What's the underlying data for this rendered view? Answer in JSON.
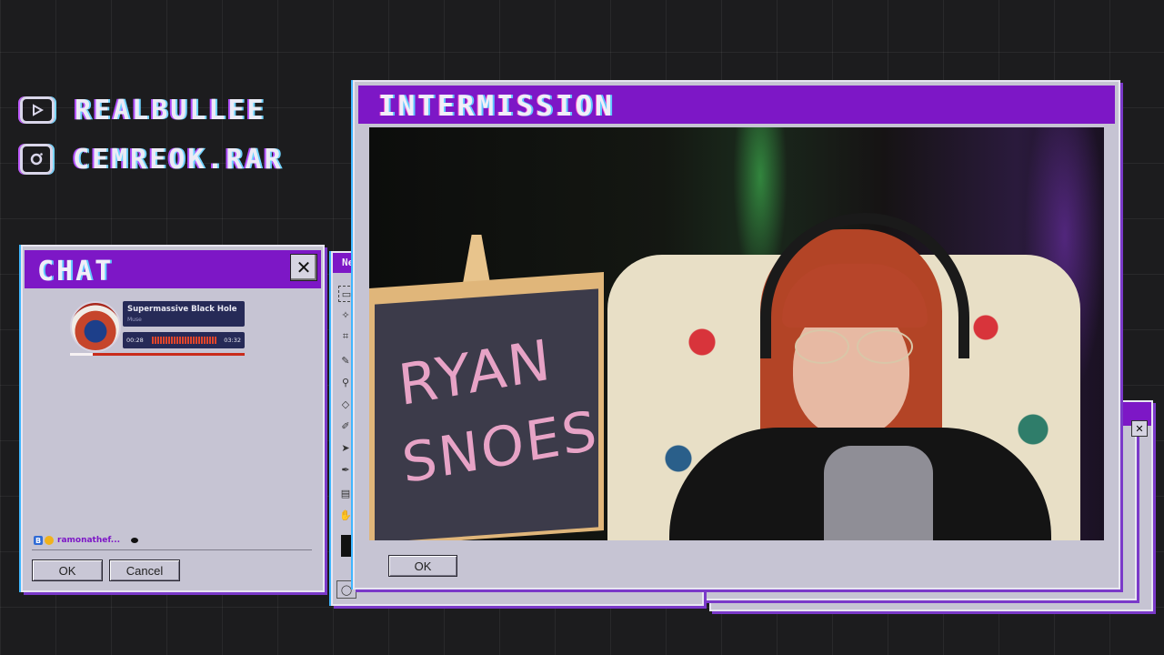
{
  "socials": [
    {
      "icon": "youtube-icon",
      "handle": "REALBULLEE"
    },
    {
      "icon": "instagram-icon",
      "handle": "CEMREOK.RAR"
    }
  ],
  "chat_window": {
    "title": "CHAT",
    "close_glyph": "✕",
    "now_playing": {
      "song_title": "Supermassive Black Hole",
      "artist": "Muse",
      "elapsed": "00:28",
      "duration": "03:32",
      "progress": 0.13
    },
    "chat_user": "ramonathef...",
    "ok_label": "OK",
    "cancel_label": "Cancel"
  },
  "paint_window": {
    "title_fragment": "Ne"
  },
  "main_window": {
    "title": "INTERMISSION",
    "ok_label": "OK",
    "sign_line1": "RYAN",
    "sign_line2": "SNOES"
  },
  "colors": {
    "accent_purple": "#7d17c6",
    "window_gray": "#c6c4d3",
    "background": "#1c1c1e",
    "music_bar_red": "#e03a1e"
  }
}
